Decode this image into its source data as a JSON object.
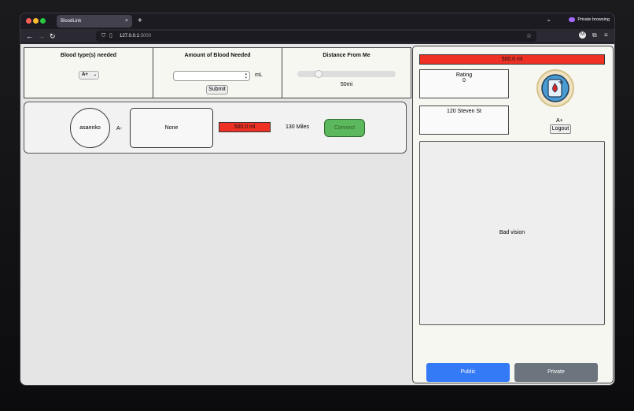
{
  "browser": {
    "tab_title": "BloodLink",
    "tab_close": "×",
    "new_tab": "+",
    "private_label": "Private browsing",
    "url_host": "127.0.0.1",
    "url_port": ":5000",
    "account_initial": "M"
  },
  "filters": {
    "blood_type_title": "Blood type(s) needed",
    "blood_type_selected": "A+",
    "amount_title": "Amount of Blood Needed",
    "amount_value": "",
    "amount_unit": "mL",
    "submit_label": "Submit",
    "distance_title": "Distance From Me",
    "distance_value": "50mi",
    "distance_slider_fraction": 0.19
  },
  "donor": {
    "username": "asaenko",
    "blood_type": "A-",
    "note": "None",
    "amount": "500.0 ml",
    "distance": "130 Miles",
    "connect_label": "Connect"
  },
  "profile": {
    "amount": "500.0 ml",
    "rating_label": "Rating",
    "rating_value": "0",
    "address": "120 Steven St",
    "blood_type": "A+",
    "logout_label": "Logout",
    "bio": "Bad vision",
    "public_label": "Public",
    "private_label": "Private"
  },
  "colors": {
    "accent_red": "#ee3124",
    "connect_green": "#5cb85c",
    "public_blue": "#3479f6",
    "private_gray": "#6c757d"
  }
}
